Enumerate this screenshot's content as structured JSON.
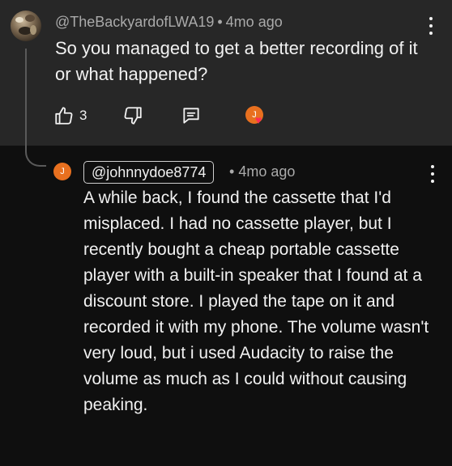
{
  "parent_comment": {
    "author": "@TheBackyardofLWA19",
    "separator": "•",
    "time": "4mo ago",
    "text": "So you managed to get a better recording of it or what happened?",
    "like_count": "3",
    "icons": [
      "like-icon",
      "dislike-icon",
      "reply-icon",
      "creator-heart-icon",
      "more-icon"
    ]
  },
  "reply": {
    "avatar_letter": "J",
    "handle": "@johnnydoe8774",
    "separator": "•",
    "time": "4mo ago",
    "text": "A while back, I found the cassette that I'd misplaced. I had no cassette player, but I recently bought a cheap portable cassette player with a built-in speaker that I found at a discount store. I played the tape on it and recorded it with my phone. The volume wasn't very loud, but i used Audacity to raise the volume as much as I could without causing peaking.",
    "icons": [
      "more-icon"
    ]
  },
  "heart_avatar_letter": "J",
  "colors": {
    "parent_bg": "#272727",
    "reply_bg": "#0f0f0f",
    "avatar_orange": "#e8701f",
    "heart_red": "#ff2d55",
    "muted_text": "#aaaaaa"
  }
}
